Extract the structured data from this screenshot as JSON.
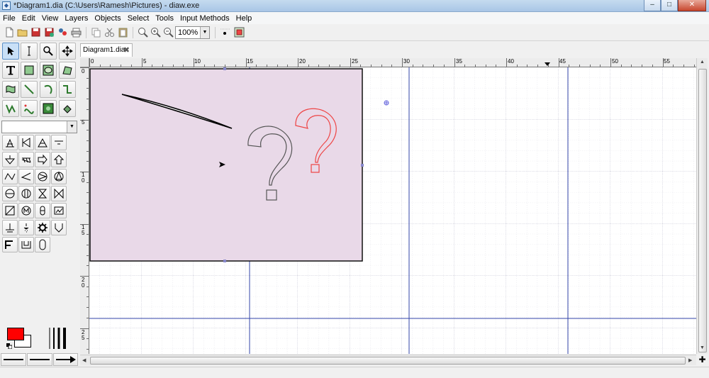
{
  "window": {
    "title": "*Diagram1.dia (C:\\Users\\Ramesh\\Pictures) - diaw.exe",
    "controls": {
      "minimize": "–",
      "maximize": "□",
      "close": "✕"
    }
  },
  "menu": {
    "items": [
      "File",
      "Edit",
      "View",
      "Layers",
      "Objects",
      "Select",
      "Tools",
      "Input Methods",
      "Help"
    ]
  },
  "toolbar": {
    "zoom_value": "100%",
    "icons": [
      "new-icon",
      "open-icon",
      "save-icon",
      "save-as-icon",
      "export-icon",
      "print-icon",
      "copy-icon",
      "cut-icon",
      "paste-icon",
      "zoom-fit-icon",
      "zoom-in-icon",
      "zoom-out-icon",
      "snap-to-grid-icon",
      "snap-to-object-icon"
    ]
  },
  "toolbox": {
    "sheet_value": "",
    "colors": {
      "foreground": "#ff0000",
      "background": "#ffffff"
    }
  },
  "document": {
    "tab_label": "Diagram1.dia",
    "tab_close": "✖"
  },
  "rulers": {
    "horizontal": [
      "0",
      "5",
      "10",
      "15",
      "20",
      "25",
      "30",
      "35",
      "40",
      "45",
      "50",
      "55"
    ],
    "vertical": [
      [
        "0"
      ],
      [
        "5"
      ],
      [
        "1",
        "0"
      ],
      [
        "1",
        "5"
      ],
      [
        "2",
        "0"
      ],
      [
        "2",
        "5"
      ]
    ]
  },
  "canvas": {
    "page_color": "#e9d9e8",
    "guide_color": "#3344aa",
    "question_mark_colors": [
      "#555555",
      "#ee4444"
    ]
  }
}
